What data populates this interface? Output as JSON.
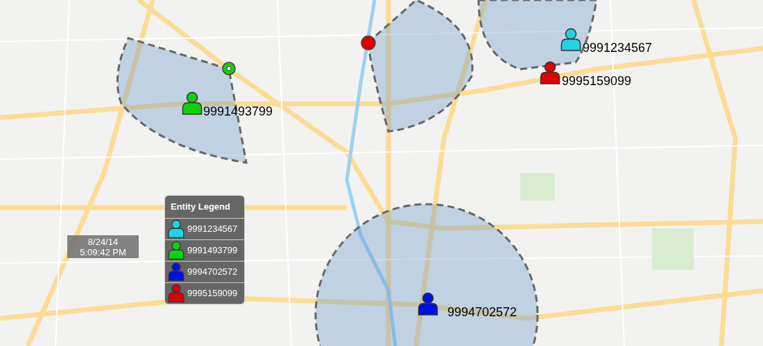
{
  "markers": [
    {
      "label": "9991234567",
      "color": "#22d3e0"
    },
    {
      "label": "9995159099",
      "color": "#e00000"
    },
    {
      "label": "9991493799",
      "color": "#10d010"
    },
    {
      "label": "9994702572",
      "color": "#0010e0"
    }
  ],
  "legend": {
    "title": "Entity Legend",
    "entries": [
      {
        "label": "9991234567",
        "color": "#22d3e0"
      },
      {
        "label": "9991493799",
        "color": "#10d010"
      },
      {
        "label": "9994702572",
        "color": "#0010e0"
      },
      {
        "label": "9995159099",
        "color": "#e00000"
      }
    ]
  },
  "timestamp": {
    "date": "8/24/14",
    "time": "5:09:42 PM"
  }
}
